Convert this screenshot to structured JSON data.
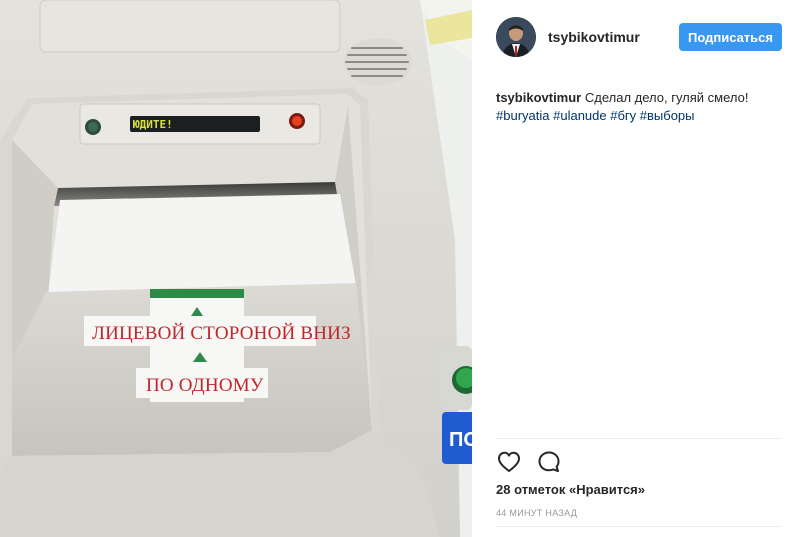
{
  "post": {
    "photo": {
      "lcd_text": "ЮДИТЕ!",
      "sticker_line1": "ЛИЦЕВОЙ СТОРОНОЙ ВНИЗ",
      "sticker_line2": "ПО ОДНОМУ",
      "side_badge": "ПО"
    },
    "header": {
      "username": "tsybikovtimur",
      "follow_label": "Подписаться"
    },
    "caption": {
      "username": "tsybikovtimur",
      "text": "Сделал дело, гуляй смело!",
      "hashtags": [
        "#buryatia",
        "#ulanude",
        "#бгу",
        "#выборы"
      ]
    },
    "actions": {
      "like_icon": "heart-icon",
      "comment_icon": "comment-icon"
    },
    "likes_text": "28 отметок «Нравится»",
    "time_text": "44 минут назад",
    "colors": {
      "follow_button": "#3897f0",
      "hashtag": "#003569",
      "stencil_red": "#c0262d",
      "badge_blue": "#1f5bd1"
    }
  }
}
